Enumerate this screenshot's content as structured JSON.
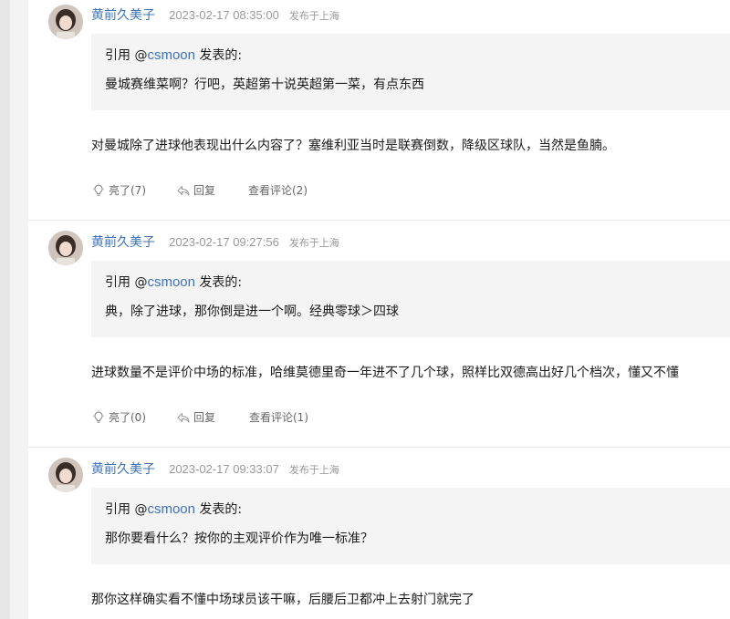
{
  "posts": [
    {
      "author": "黄前久美子",
      "timestamp": "2023-02-17 08:35:00",
      "location": "发布于上海",
      "quote": {
        "prefix": "引用 @",
        "user": "csmoon",
        "suffix": " 发表的:",
        "text": "曼城赛维菜啊？行吧，英超第十说英超第一菜，有点东西"
      },
      "reply": "对曼城除了进球他表现出什么内容了？塞维利亚当时是联赛倒数，降级区球队，当然是鱼腩。",
      "actions": {
        "like": "亮了(7)",
        "reply": "回复",
        "comments": "查看评论(2)"
      }
    },
    {
      "author": "黄前久美子",
      "timestamp": "2023-02-17 09:27:56",
      "location": "发布于上海",
      "quote": {
        "prefix": "引用 @",
        "user": "csmoon",
        "suffix": " 发表的:",
        "text": "典，除了进球，那你倒是进一个啊。经典零球＞四球"
      },
      "reply": "进球数量不是评价中场的标准，哈维莫德里奇一年进不了几个球，照样比双德高出好几个档次，懂又不懂",
      "actions": {
        "like": "亮了(0)",
        "reply": "回复",
        "comments": "查看评论(1)"
      }
    },
    {
      "author": "黄前久美子",
      "timestamp": "2023-02-17 09:33:07",
      "location": "发布于上海",
      "quote": {
        "prefix": "引用 @",
        "user": "csmoon",
        "suffix": " 发表的:",
        "text": "那你要看什么？按你的主观评价作为唯一标准？"
      },
      "reply": "那你这样确实看不懂中场球员该干嘛，后腰后卫都冲上去射门就完了"
    }
  ],
  "icons": {
    "like": "lightbulb-icon",
    "reply": "reply-arrow-icon"
  },
  "colors": {
    "link": "#3f73b4",
    "meta": "#9a9a9a",
    "quote_bg": "#f4f4f4",
    "action": "#666666"
  }
}
